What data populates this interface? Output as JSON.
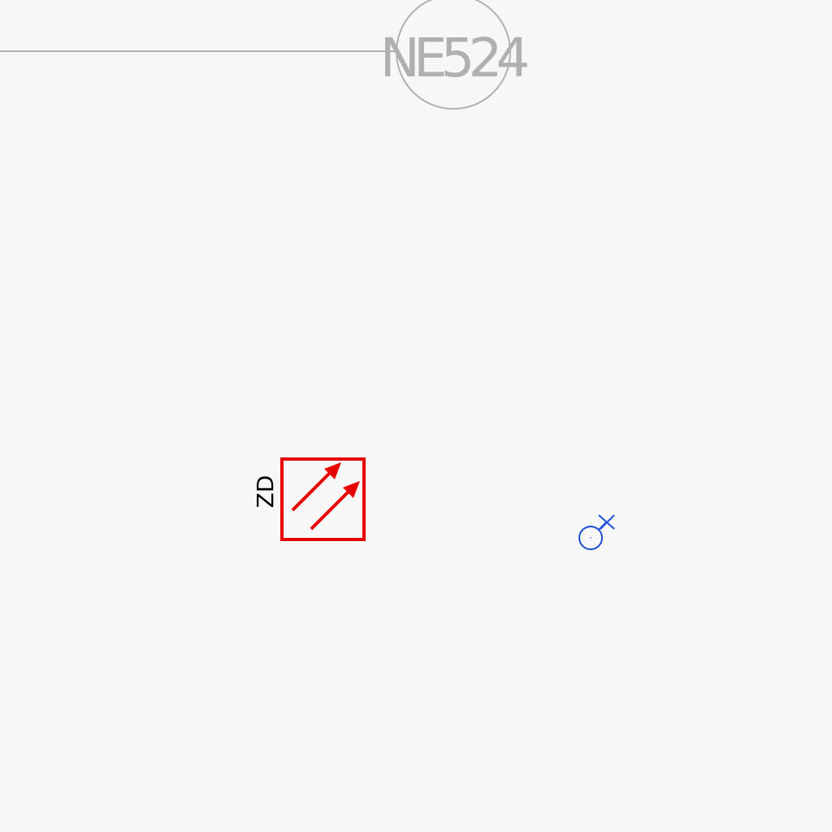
{
  "diagram": {
    "node_label": "NE524",
    "device_label": "ZD",
    "colors": {
      "background": "#f7f7f7",
      "line": "#b0b0b0",
      "device": "#e60000",
      "symbol": "#1a4fd6",
      "label": "#000000"
    },
    "icons": {
      "node": "circle-node-icon",
      "device": "double-arrow-box-icon",
      "symbol": "circle-cross-icon"
    }
  }
}
